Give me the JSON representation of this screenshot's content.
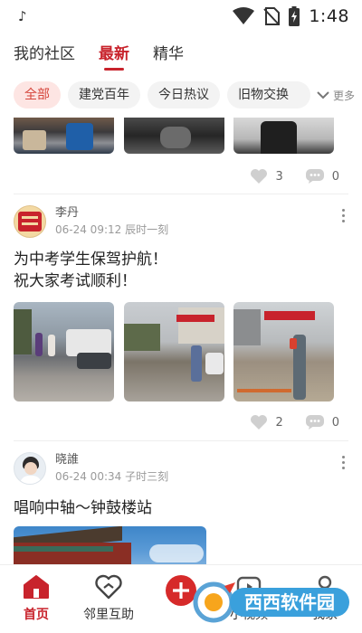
{
  "status_bar": {
    "time": "1:48"
  },
  "top_tabs": [
    {
      "label": "我的社区",
      "active": false
    },
    {
      "label": "最新",
      "active": true
    },
    {
      "label": "精华",
      "active": false
    }
  ],
  "categories": [
    {
      "label": "全部",
      "active": true
    },
    {
      "label": "建党百年",
      "active": false
    },
    {
      "label": "今日热议",
      "active": false
    },
    {
      "label": "旧物交换",
      "active": false
    }
  ],
  "more_label": "更多",
  "post1": {
    "likes": "3",
    "comments": "0"
  },
  "post2": {
    "author": "李丹",
    "date": "06-24 09:12",
    "period": "辰时一刻",
    "text_lines": [
      "为中考学生保驾护航！",
      "祝大家考试顺利！"
    ],
    "likes": "2",
    "comments": "0"
  },
  "post3": {
    "author": "晓誰",
    "date": "06-24 00:34",
    "period": "子时三刻",
    "text": "唱响中轴～钟鼓楼站"
  },
  "bottom_nav": [
    {
      "label": "首页",
      "icon": "home-icon",
      "active": true
    },
    {
      "label": "邻里互助",
      "icon": "heart-hands-icon",
      "active": false
    },
    {
      "label": "",
      "icon": "add-icon",
      "active": false
    },
    {
      "label": "小视频",
      "icon": "video-icon",
      "active": false
    },
    {
      "label": "我家",
      "icon": "user-icon",
      "active": false
    }
  ],
  "watermark": {
    "text": "西西软件园"
  },
  "colors": {
    "accent": "#c8232c",
    "chip_active_bg": "#fde5e3",
    "chip_bg": "#f3f3f3"
  }
}
